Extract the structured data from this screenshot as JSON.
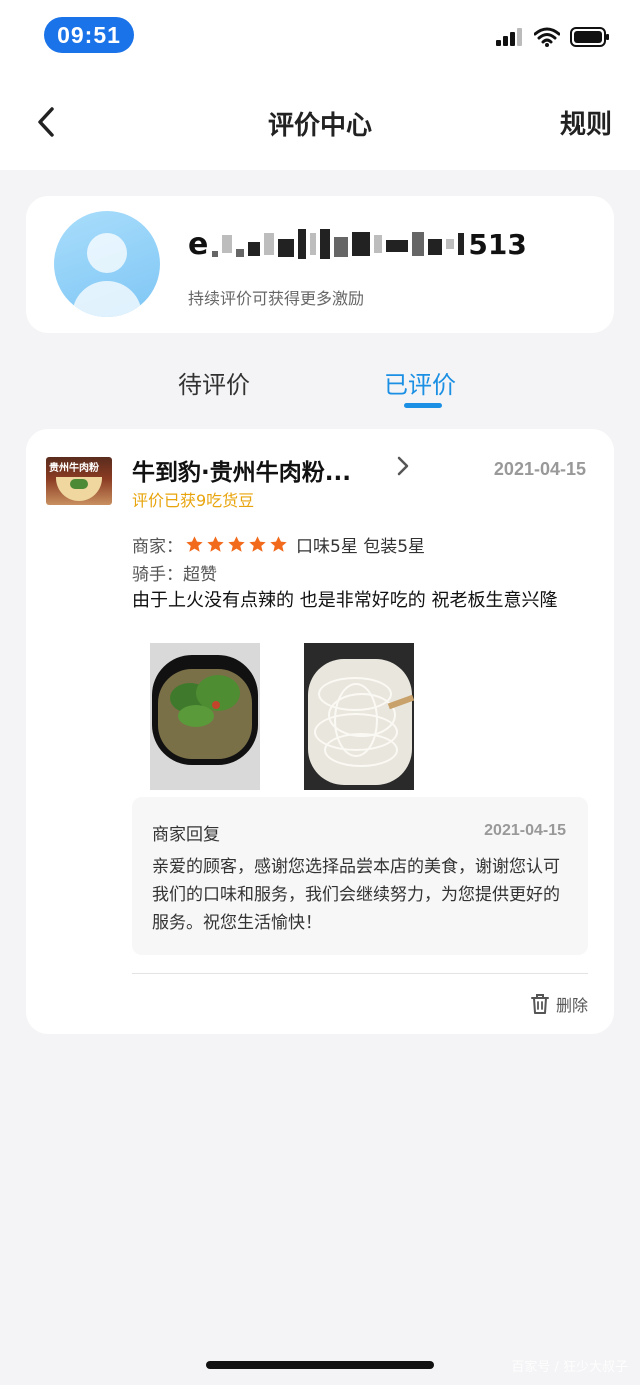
{
  "status_bar": {
    "time": "09:51"
  },
  "nav": {
    "title": "评价中心",
    "rules": "规则"
  },
  "profile": {
    "username_prefix": "e",
    "username_suffix": "513",
    "incentive": "持续评价可获得更多激励"
  },
  "tabs": [
    {
      "label": "待评价",
      "active": false
    },
    {
      "label": "已评价",
      "active": true
    }
  ],
  "review": {
    "shop_thumb_text": "贵州牛肉粉",
    "shop_name": "牛到豹·贵州牛肉粉...",
    "date": "2021-04-15",
    "bonus": "评价已获9吃货豆",
    "merchant_label": "商家：",
    "stars": 5,
    "ratings": "口味5星 包装5星",
    "rider": "骑手：超赞",
    "text": "由于上火没有点辣的 也是非常好吃的 祝老板生意兴隆",
    "reply": {
      "title": "商家回复",
      "date": "2021-04-15",
      "text": "亲爱的顾客，感谢您选择品尝本店的美食，谢谢您认可我们的口味和服务，我们会继续努力，为您提供更好的服务。祝您生活愉快！"
    },
    "delete": "删除"
  },
  "watermark": "百家号 / 狂少大叔子",
  "colors": {
    "accent": "#1a8fe3",
    "star": "#f26a1b",
    "bonus": "#e8a40c"
  }
}
